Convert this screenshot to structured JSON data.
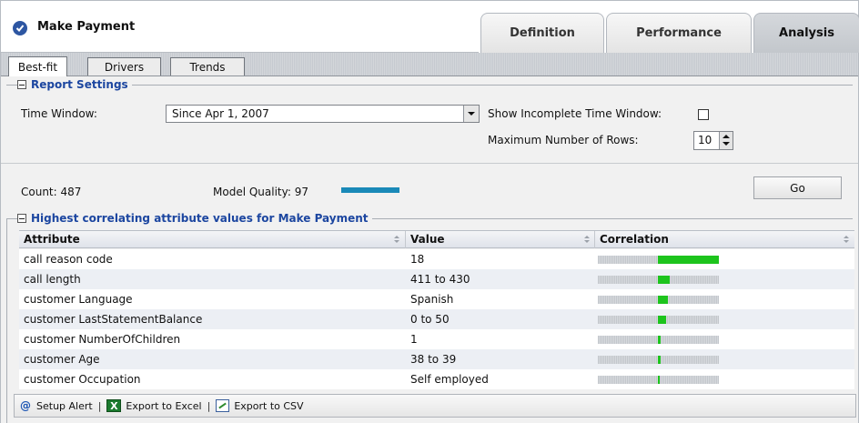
{
  "header": {
    "title": "Make Payment",
    "tabs": [
      {
        "label": "Definition",
        "active": false
      },
      {
        "label": "Performance",
        "active": false
      },
      {
        "label": "Analysis",
        "active": true
      }
    ]
  },
  "subtabs": [
    {
      "label": "Best-fit",
      "active": true
    },
    {
      "label": "Drivers",
      "active": false
    },
    {
      "label": "Trends",
      "active": false
    }
  ],
  "report_settings": {
    "legend": "Report Settings",
    "time_window_label": "Time Window:",
    "time_window_value": "Since Apr 1, 2007",
    "show_incomplete_label": "Show Incomplete Time Window:",
    "show_incomplete_checked": false,
    "max_rows_label": "Maximum Number of Rows:",
    "max_rows_value": "10"
  },
  "summary": {
    "count_label": "Count: 487",
    "model_quality_label": "Model Quality: 97",
    "model_quality_value": 97,
    "go_label": "Go"
  },
  "results": {
    "legend": "Highest correlating attribute values for Make Payment",
    "columns": [
      "Attribute",
      "Value",
      "Correlation"
    ],
    "rows": [
      {
        "attribute": "call reason code",
        "value": "18",
        "correlation": 0.5
      },
      {
        "attribute": "call length",
        "value": "411 to 430",
        "correlation": 0.1
      },
      {
        "attribute": "customer Language",
        "value": "Spanish",
        "correlation": 0.08
      },
      {
        "attribute": "customer LastStatementBalance",
        "value": "0 to 50",
        "correlation": 0.07
      },
      {
        "attribute": "customer NumberOfChildren",
        "value": "1",
        "correlation": 0.025
      },
      {
        "attribute": "customer Age",
        "value": "38 to 39",
        "correlation": 0.02
      },
      {
        "attribute": "customer Occupation",
        "value": "Self employed",
        "correlation": 0.015
      }
    ]
  },
  "footer": {
    "setup_alert": "Setup Alert",
    "export_excel": "Export to Excel",
    "export_csv": "Export to CSV"
  },
  "colors": {
    "accent_blue": "#1c46a0",
    "quality_bar": "#1a89b8",
    "correlation_fill": "#1dc41d"
  }
}
